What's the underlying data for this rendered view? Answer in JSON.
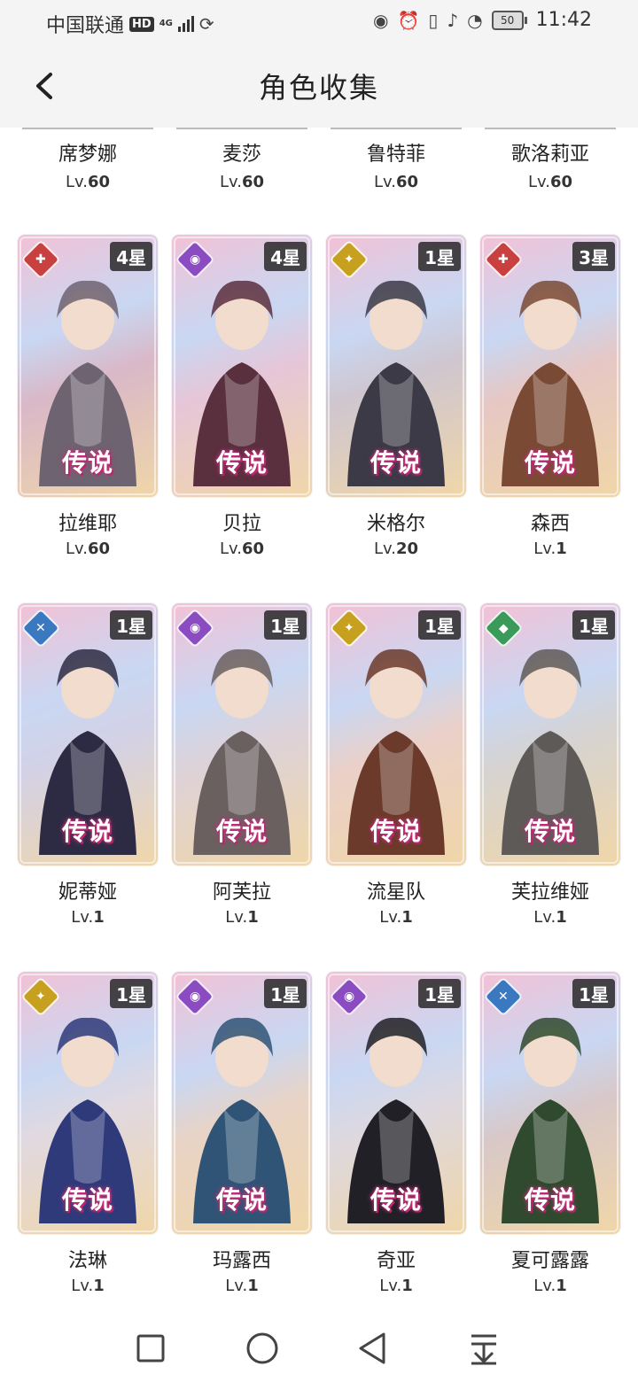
{
  "status_bar": {
    "carrier": "中国联通",
    "hd": "HD",
    "network": "4G",
    "battery": "50",
    "time": "11:42"
  },
  "header": {
    "title": "角色收集"
  },
  "rarity_label": "传说",
  "level_prefix": "Lv.",
  "top_row": [
    {
      "name": "席梦娜",
      "level": "60"
    },
    {
      "name": "麦莎",
      "level": "60"
    },
    {
      "name": "鲁特菲",
      "level": "60"
    },
    {
      "name": "歌洛莉亚",
      "level": "60"
    }
  ],
  "characters": [
    {
      "name": "拉维耶",
      "level": "60",
      "stars": "4星",
      "element": "red",
      "element_color": "#c84040",
      "glyph": "✚",
      "palette": [
        "#d9b8c8",
        "#6e6370"
      ]
    },
    {
      "name": "贝拉",
      "level": "60",
      "stars": "4星",
      "element": "purple",
      "element_color": "#8a4cc0",
      "glyph": "◉",
      "palette": [
        "#e6c6d8",
        "#5a2f3e"
      ]
    },
    {
      "name": "米格尔",
      "level": "20",
      "stars": "1星",
      "element": "yellow",
      "element_color": "#c8a020",
      "glyph": "✦",
      "palette": [
        "#cfc6cf",
        "#3b3a46"
      ]
    },
    {
      "name": "森西",
      "level": "1",
      "stars": "3星",
      "element": "red",
      "element_color": "#c84040",
      "glyph": "✚",
      "palette": [
        "#e6c7c4",
        "#7a4a34"
      ]
    },
    {
      "name": "妮蒂娅",
      "level": "1",
      "stars": "1星",
      "element": "blue",
      "element_color": "#3a78c0",
      "glyph": "✕",
      "palette": [
        "#d3d1e6",
        "#2d2b44"
      ]
    },
    {
      "name": "阿芙拉",
      "level": "1",
      "stars": "1星",
      "element": "purple",
      "element_color": "#8a4cc0",
      "glyph": "◉",
      "palette": [
        "#ddd2d8",
        "#6b6060"
      ]
    },
    {
      "name": "流星队",
      "level": "1",
      "stars": "1星",
      "element": "yellow",
      "element_color": "#c8a020",
      "glyph": "✦",
      "palette": [
        "#ead0c8",
        "#6b3a2a"
      ]
    },
    {
      "name": "芙拉维娅",
      "level": "1",
      "stars": "1星",
      "element": "green",
      "element_color": "#3a9a5a",
      "glyph": "◆",
      "palette": [
        "#d6d3d0",
        "#5e5a58"
      ]
    },
    {
      "name": "法琳",
      "level": "1",
      "stars": "1星",
      "element": "yellow",
      "element_color": "#c8a020",
      "glyph": "✦",
      "palette": [
        "#e1d9e0",
        "#2e3a7a"
      ]
    },
    {
      "name": "玛露西",
      "level": "1",
      "stars": "1星",
      "element": "purple",
      "element_color": "#8a4cc0",
      "glyph": "◉",
      "palette": [
        "#e8d3c6",
        "#2f5476"
      ]
    },
    {
      "name": "奇亚",
      "level": "1",
      "stars": "1星",
      "element": "purple",
      "element_color": "#8a4cc0",
      "glyph": "◉",
      "palette": [
        "#ddd8e0",
        "#202026"
      ]
    },
    {
      "name": "夏可露露",
      "level": "1",
      "stars": "1星",
      "element": "blue",
      "element_color": "#3a78c0",
      "glyph": "✕",
      "palette": [
        "#d8c8c8",
        "#2f4a2e"
      ]
    }
  ],
  "nav": {
    "recent": "square-icon",
    "home": "circle-icon",
    "back": "triangle-back-icon",
    "menu": "pull-down-icon"
  }
}
